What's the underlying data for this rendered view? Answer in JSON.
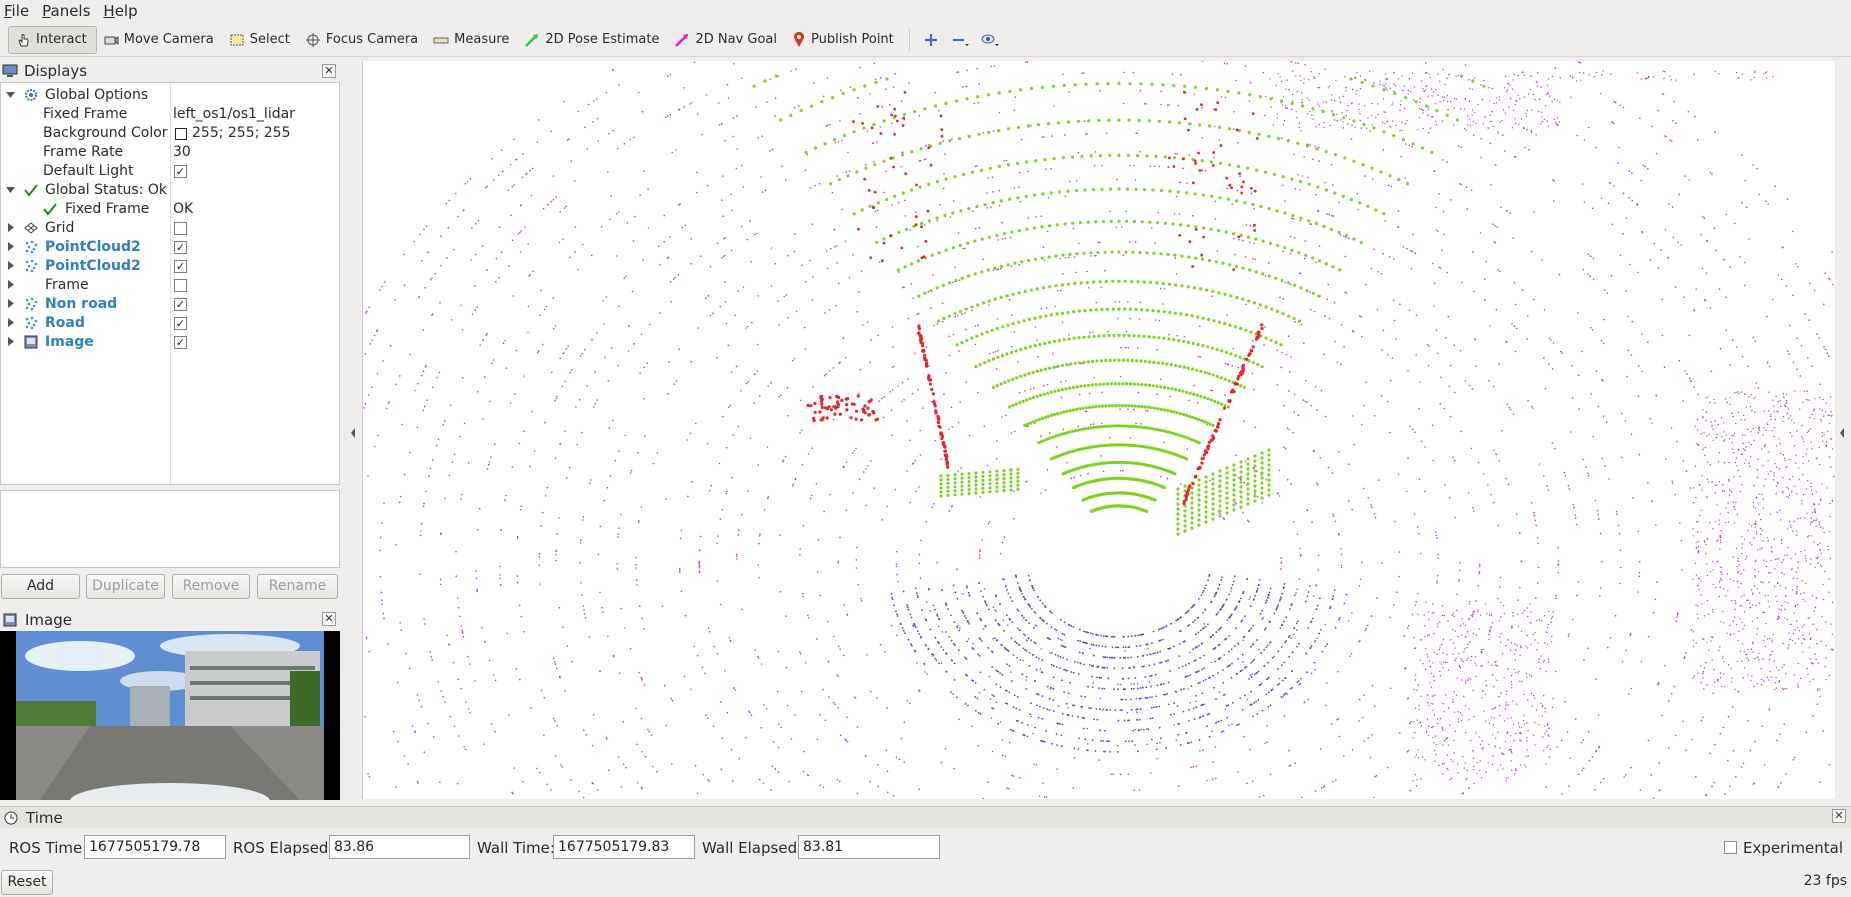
{
  "menu": [
    "File",
    "Panels",
    "Help"
  ],
  "toolbar": {
    "interact": "Interact",
    "move_camera": "Move Camera",
    "select": "Select",
    "focus_camera": "Focus Camera",
    "measure": "Measure",
    "pose_estimate": "2D Pose Estimate",
    "nav_goal": "2D Nav Goal",
    "publish_point": "Publish Point"
  },
  "displays": {
    "title": "Displays",
    "global_options": {
      "label": "Global Options",
      "fixed_frame_label": "Fixed Frame",
      "fixed_frame_value": "left_os1/os1_lidar",
      "bg_color_label": "Background Color",
      "bg_color_value": "255; 255; 255",
      "frame_rate_label": "Frame Rate",
      "frame_rate_value": "30",
      "default_light_label": "Default Light",
      "default_light_checked": true
    },
    "global_status": {
      "label": "Global Status: Ok",
      "fixed_frame_label": "Fixed Frame",
      "fixed_frame_value": "OK"
    },
    "items": [
      {
        "label": "Grid",
        "checked": false,
        "bold": false
      },
      {
        "label": "PointCloud2",
        "checked": true,
        "bold": true
      },
      {
        "label": "PointCloud2",
        "checked": true,
        "bold": true
      },
      {
        "label": "Frame",
        "checked": false,
        "bold": false
      },
      {
        "label": "Non road",
        "checked": true,
        "bold": true
      },
      {
        "label": "Road",
        "checked": true,
        "bold": true
      },
      {
        "label": "Image",
        "checked": true,
        "bold": true
      }
    ],
    "buttons": {
      "add": "Add",
      "duplicate": "Duplicate",
      "remove": "Remove",
      "rename": "Rename"
    }
  },
  "image_panel": {
    "title": "Image"
  },
  "time": {
    "title": "Time",
    "ros_time_label": "ROS Time:",
    "ros_time_value": "1677505179.78",
    "ros_elapsed_label": "ROS Elapsed:",
    "ros_elapsed_value": "83.86",
    "wall_time_label": "Wall Time:",
    "wall_time_value": "1677505179.83",
    "wall_elapsed_label": "Wall Elapsed:",
    "wall_elapsed_value": "83.81",
    "experimental_label": "Experimental",
    "reset_label": "Reset",
    "fps": "23 fps"
  },
  "colors": {
    "road": "#7ed321",
    "non_road": "#e8232b",
    "background_cloud": "#b23bdc",
    "near_cloud": "#5b3fd8",
    "label_blue": "#2f7fc0"
  }
}
